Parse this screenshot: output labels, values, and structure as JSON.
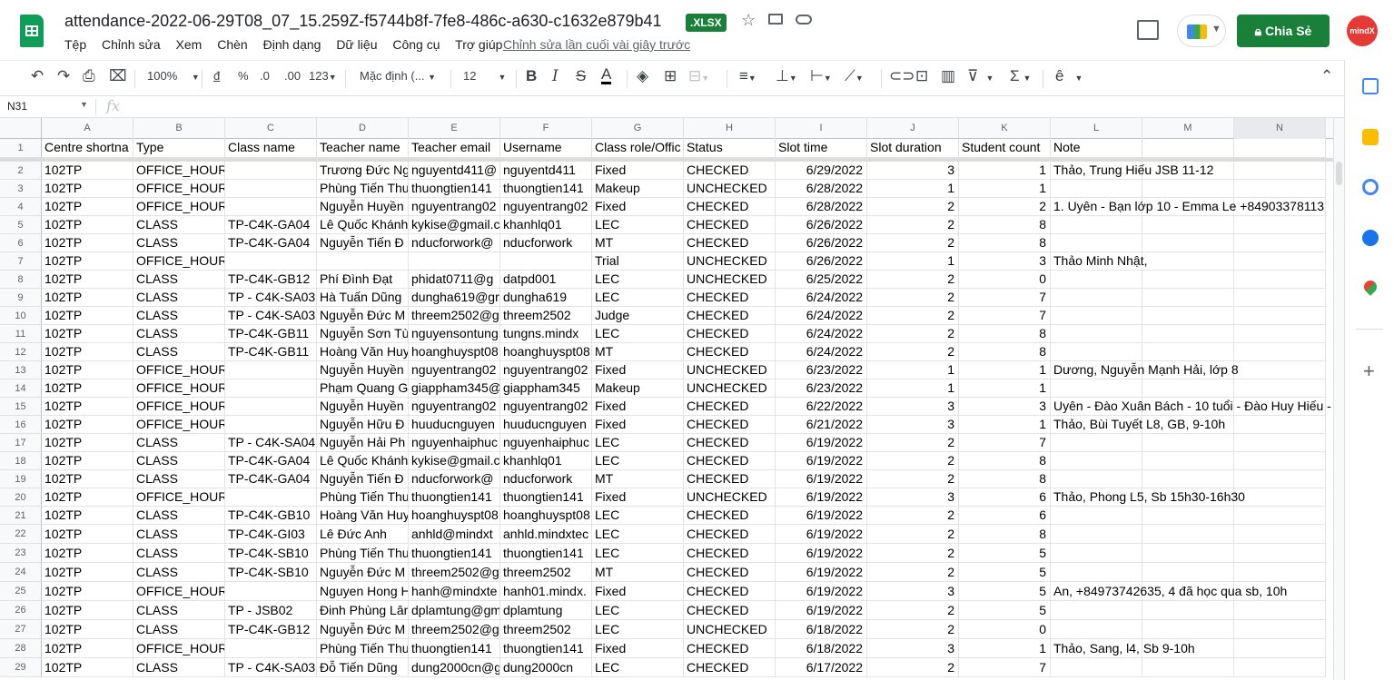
{
  "header": {
    "title": "attendance-2022-06-29T08_07_15.259Z-f5744b8f-7fe8-486c-a630-c1632e879b41",
    "badge": ".XLSX",
    "menu": [
      "Tệp",
      "Chỉnh sửa",
      "Xem",
      "Chèn",
      "Định dạng",
      "Dữ liệu",
      "Công cụ",
      "Trợ giúp"
    ],
    "last_edit": "Chỉnh sửa lần cuối vài giây trước",
    "share_label": "Chia Sẻ",
    "avatar_text": "mindX"
  },
  "toolbar": {
    "zoom": "100%",
    "currency": "đ",
    "percent": "%",
    "dec_decrease": ".0",
    "dec_increase": ".00",
    "more_formats": "123",
    "font": "Mặc định (...",
    "font_size": "12"
  },
  "formula_bar": {
    "cell_ref": "N31",
    "fx": "fx"
  },
  "columns": [
    "A",
    "B",
    "C",
    "D",
    "E",
    "F",
    "G",
    "H",
    "I",
    "J",
    "K",
    "L",
    "M",
    "N"
  ],
  "header_row": {
    "num": "1",
    "cells": [
      "Centre shortna",
      "Type",
      "Class name",
      "Teacher name",
      "Teacher email",
      "Username",
      "Class role/Offic",
      "Status",
      "Slot time",
      "Slot duration",
      "Student count",
      "Note"
    ]
  },
  "rows": [
    {
      "num": "2",
      "a": "102TP",
      "b": "OFFICE_HOURS",
      "c": "",
      "d": "Trương Đức Ng",
      "e": "nguyentd411@",
      "f": "nguyentd411",
      "g": "Fixed",
      "h": "CHECKED",
      "i": "6/29/2022",
      "j": "3",
      "k": "1",
      "l": "Thảo, Trung Hiếu JSB 11-12"
    },
    {
      "num": "3",
      "a": "102TP",
      "b": "OFFICE_HOURS",
      "c": "",
      "d": "Phùng Tiến Thư",
      "e": "thuongtien141",
      "f": "thuongtien141",
      "g": "Makeup",
      "h": "UNCHECKED",
      "i": "6/28/2022",
      "j": "1",
      "k": "1",
      "l": ""
    },
    {
      "num": "4",
      "a": "102TP",
      "b": "OFFICE_HOURS",
      "c": "",
      "d": "Nguyễn Huyền",
      "e": "nguyentrang02",
      "f": "nguyentrang02",
      "g": "Fixed",
      "h": "CHECKED",
      "i": "6/28/2022",
      "j": "2",
      "k": "2",
      "l": "1. Uyên - Bạn lớp 10 - Emma Le +84903378113"
    },
    {
      "num": "5",
      "a": "102TP",
      "b": "CLASS",
      "c": "TP-C4K-GA04",
      "d": "Lê Quốc Khánh",
      "e": "kykise@gmail.c",
      "f": "khanhlq01",
      "g": "LEC",
      "h": "CHECKED",
      "i": "6/26/2022",
      "j": "2",
      "k": "8",
      "l": ""
    },
    {
      "num": "6",
      "a": "102TP",
      "b": "CLASS",
      "c": "TP-C4K-GA04",
      "d": "Nguyễn Tiến Đ",
      "e": "nducforwork@",
      "f": "nducforwork",
      "g": "MT",
      "h": "CHECKED",
      "i": "6/26/2022",
      "j": "2",
      "k": "8",
      "l": ""
    },
    {
      "num": "7",
      "a": "102TP",
      "b": "OFFICE_HOURS",
      "c": "",
      "d": "",
      "e": "",
      "f": "",
      "g": "Trial",
      "h": "UNCHECKED",
      "i": "6/26/2022",
      "j": "1",
      "k": "3",
      "l": "Thảo Minh Nhật,"
    },
    {
      "num": "8",
      "a": "102TP",
      "b": "CLASS",
      "c": "TP-C4K-GB12",
      "d": "Phí Đình Đạt",
      "e": "phidat0711@g",
      "f": "datpd001",
      "g": "LEC",
      "h": "UNCHECKED",
      "i": "6/25/2022",
      "j": "2",
      "k": "0",
      "l": ""
    },
    {
      "num": "9",
      "a": "102TP",
      "b": "CLASS",
      "c": "TP - C4K-SA03",
      "d": "Hà Tuấn Dũng",
      "e": "dungha619@gr",
      "f": "dungha619",
      "g": "LEC",
      "h": "CHECKED",
      "i": "6/24/2022",
      "j": "2",
      "k": "7",
      "l": ""
    },
    {
      "num": "10",
      "a": "102TP",
      "b": "CLASS",
      "c": "TP - C4K-SA03",
      "d": "Nguyễn Đức M",
      "e": "threem2502@g",
      "f": "threem2502",
      "g": "Judge",
      "h": "CHECKED",
      "i": "6/24/2022",
      "j": "2",
      "k": "7",
      "l": ""
    },
    {
      "num": "11",
      "a": "102TP",
      "b": "CLASS",
      "c": "TP-C4K-GB11",
      "d": "Nguyễn Sơn Tù",
      "e": "nguyensontung",
      "f": "tungns.mindx",
      "g": "LEC",
      "h": "CHECKED",
      "i": "6/24/2022",
      "j": "2",
      "k": "8",
      "l": ""
    },
    {
      "num": "12",
      "a": "102TP",
      "b": "CLASS",
      "c": "TP-C4K-GB11",
      "d": "Hoàng Văn Huy",
      "e": "hoanghuyspt08",
      "f": "hoanghuyspt08",
      "g": "MT",
      "h": "CHECKED",
      "i": "6/24/2022",
      "j": "2",
      "k": "8",
      "l": ""
    },
    {
      "num": "13",
      "a": "102TP",
      "b": "OFFICE_HOURS",
      "c": "",
      "d": "Nguyễn Huyền",
      "e": "nguyentrang02",
      "f": "nguyentrang02",
      "g": "Fixed",
      "h": "UNCHECKED",
      "i": "6/23/2022",
      "j": "1",
      "k": "1",
      "l": "Dương, Nguyễn Mạnh Hải, lớp 8"
    },
    {
      "num": "14",
      "a": "102TP",
      "b": "OFFICE_HOURS",
      "c": "",
      "d": "Phạm Quang G",
      "e": "giappham345@",
      "f": "giappham345",
      "g": "Makeup",
      "h": "UNCHECKED",
      "i": "6/23/2022",
      "j": "1",
      "k": "1",
      "l": ""
    },
    {
      "num": "15",
      "a": "102TP",
      "b": "OFFICE_HOURS",
      "c": "",
      "d": "Nguyễn Huyền",
      "e": "nguyentrang02",
      "f": "nguyentrang02",
      "g": "Fixed",
      "h": "CHECKED",
      "i": "6/22/2022",
      "j": "3",
      "k": "3",
      "l": "Uyên - Đào Xuân Bách - 10 tuổi - Đào Huy Hiếu -"
    },
    {
      "num": "16",
      "a": "102TP",
      "b": "OFFICE_HOURS",
      "c": "",
      "d": "Nguyễn Hữu Đ",
      "e": "huuducnguyen",
      "f": "huuducnguyen",
      "g": "Fixed",
      "h": "CHECKED",
      "i": "6/21/2022",
      "j": "3",
      "k": "1",
      "l": "Thảo, Bùi Tuyết L8, GB, 9-10h"
    },
    {
      "num": "17",
      "a": "102TP",
      "b": "CLASS",
      "c": "TP - C4K-SA04",
      "d": "Nguyễn Hải Ph",
      "e": "nguyenhaiphuc",
      "f": "nguyenhaiphuc",
      "g": "LEC",
      "h": "CHECKED",
      "i": "6/19/2022",
      "j": "2",
      "k": "7",
      "l": ""
    },
    {
      "num": "18",
      "a": "102TP",
      "b": "CLASS",
      "c": "TP-C4K-GA04",
      "d": "Lê Quốc Khánh",
      "e": "kykise@gmail.c",
      "f": "khanhlq01",
      "g": "LEC",
      "h": "CHECKED",
      "i": "6/19/2022",
      "j": "2",
      "k": "8",
      "l": ""
    },
    {
      "num": "19",
      "a": "102TP",
      "b": "CLASS",
      "c": "TP-C4K-GA04",
      "d": "Nguyễn Tiến Đ",
      "e": "nducforwork@",
      "f": "nducforwork",
      "g": "MT",
      "h": "CHECKED",
      "i": "6/19/2022",
      "j": "2",
      "k": "8",
      "l": ""
    },
    {
      "num": "20",
      "a": "102TP",
      "b": "OFFICE_HOURS",
      "c": "",
      "d": "Phùng Tiến Thư",
      "e": "thuongtien141",
      "f": "thuongtien141",
      "g": "Fixed",
      "h": "UNCHECKED",
      "i": "6/19/2022",
      "j": "3",
      "k": "6",
      "l": "Thảo, Phong L5, Sb 15h30-16h30"
    },
    {
      "num": "21",
      "a": "102TP",
      "b": "CLASS",
      "c": "TP-C4K-GB10",
      "d": "Hoàng Văn Huy",
      "e": "hoanghuyspt08",
      "f": "hoanghuyspt08",
      "g": "LEC",
      "h": "CHECKED",
      "i": "6/19/2022",
      "j": "2",
      "k": "6",
      "l": ""
    },
    {
      "num": "22",
      "a": "102TP",
      "b": "CLASS",
      "c": "TP-C4K-GI03",
      "d": "Lê Đức Anh",
      "e": "anhld@mindxt",
      "f": "anhld.mindxtec",
      "g": "LEC",
      "h": "CHECKED",
      "i": "6/19/2022",
      "j": "2",
      "k": "8",
      "l": ""
    },
    {
      "num": "23",
      "a": "102TP",
      "b": "CLASS",
      "c": "TP-C4K-SB10",
      "d": "Phùng Tiến Thư",
      "e": "thuongtien141",
      "f": "thuongtien141",
      "g": "LEC",
      "h": "CHECKED",
      "i": "6/19/2022",
      "j": "2",
      "k": "5",
      "l": ""
    },
    {
      "num": "24",
      "a": "102TP",
      "b": "CLASS",
      "c": "TP-C4K-SB10",
      "d": "Nguyễn Đức M",
      "e": "threem2502@g",
      "f": "threem2502",
      "g": "MT",
      "h": "CHECKED",
      "i": "6/19/2022",
      "j": "2",
      "k": "5",
      "l": ""
    },
    {
      "num": "25",
      "a": "102TP",
      "b": "OFFICE_HOURS",
      "c": "",
      "d": "Nguyen Hong H",
      "e": "hanh@mindxte",
      "f": "hanh01.mindx.",
      "g": "Fixed",
      "h": "CHECKED",
      "i": "6/19/2022",
      "j": "3",
      "k": "5",
      "l": "An, +84973742635, 4 đã học qua sb, 10h"
    },
    {
      "num": "26",
      "a": "102TP",
      "b": "CLASS",
      "c": "TP - JSB02",
      "d": "Đinh Phùng Lâm",
      "e": "dplamtung@gm",
      "f": "dplamtung",
      "g": "LEC",
      "h": "CHECKED",
      "i": "6/19/2022",
      "j": "2",
      "k": "5",
      "l": ""
    },
    {
      "num": "27",
      "a": "102TP",
      "b": "CLASS",
      "c": "TP-C4K-GB12",
      "d": "Nguyễn Đức M",
      "e": "threem2502@g",
      "f": "threem2502",
      "g": "LEC",
      "h": "UNCHECKED",
      "i": "6/18/2022",
      "j": "2",
      "k": "0",
      "l": ""
    },
    {
      "num": "28",
      "a": "102TP",
      "b": "OFFICE_HOURS",
      "c": "",
      "d": "Phùng Tiến Thư",
      "e": "thuongtien141",
      "f": "thuongtien141",
      "g": "Fixed",
      "h": "CHECKED",
      "i": "6/18/2022",
      "j": "3",
      "k": "1",
      "l": "Thảo, Sang, l4, Sb 9-10h"
    },
    {
      "num": "29",
      "a": "102TP",
      "b": "CLASS",
      "c": "TP - C4K-SA03",
      "d": "Đỗ Tiến Dũng",
      "e": "dung2000cn@g",
      "f": "dung2000cn",
      "g": "LEC",
      "h": "CHECKED",
      "i": "6/17/2022",
      "j": "2",
      "k": "7",
      "l": ""
    }
  ]
}
